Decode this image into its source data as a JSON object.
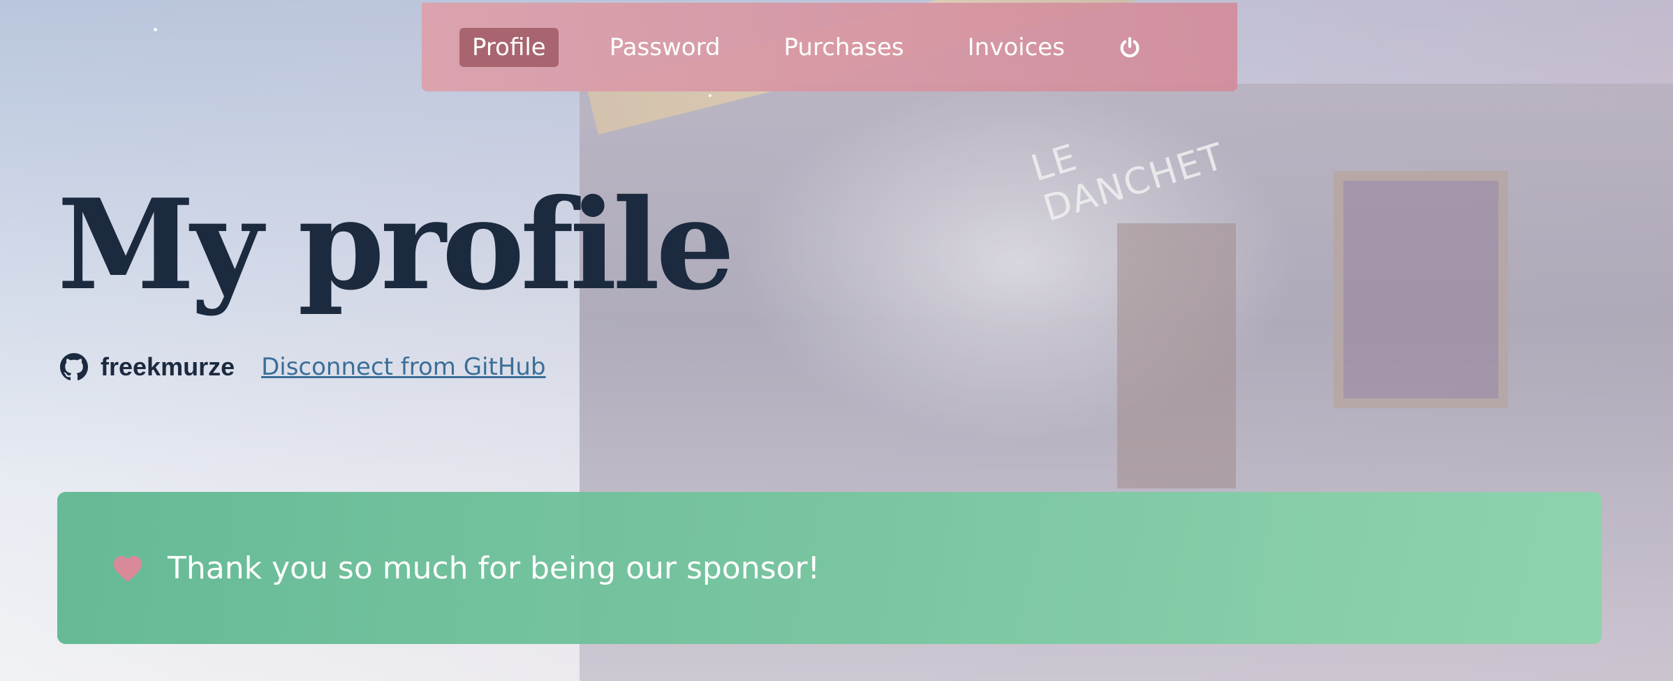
{
  "nav": {
    "items": [
      {
        "label": "Profile",
        "active": true
      },
      {
        "label": "Password",
        "active": false
      },
      {
        "label": "Purchases",
        "active": false
      },
      {
        "label": "Invoices",
        "active": false
      }
    ],
    "logout_icon": "power-icon"
  },
  "header": {
    "title": "My profile"
  },
  "account": {
    "icon": "github-icon",
    "username": "freekmurze",
    "disconnect_label": "Disconnect from GitHub"
  },
  "sponsor": {
    "icon": "heart-icon",
    "message": "Thank you so much for being our sponsor!"
  },
  "background": {
    "sign_text": "LE DANCHET"
  },
  "colors": {
    "title": "#1b2a3f",
    "link": "#3b6e97",
    "nav_bg": "#d9a0aa",
    "nav_active": "#a05a64",
    "banner": "#6cc095",
    "heart": "#d98a98"
  }
}
